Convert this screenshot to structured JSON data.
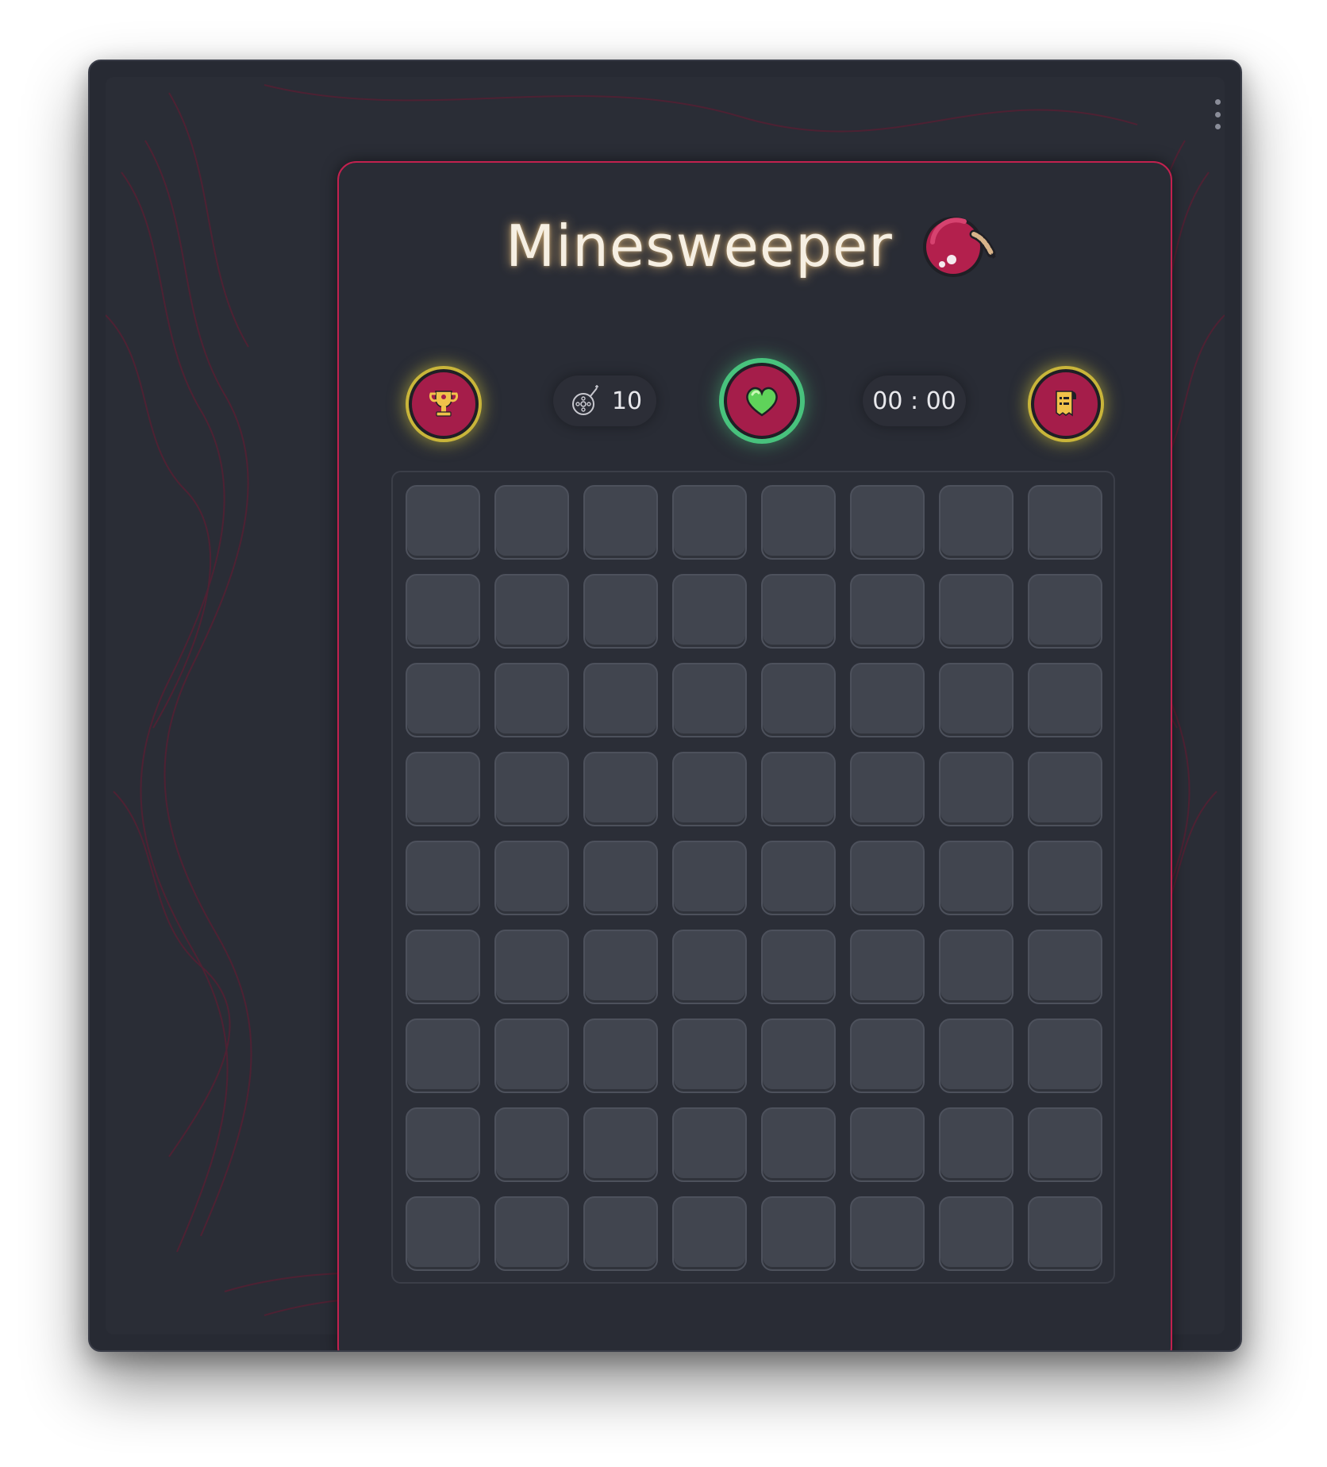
{
  "app": {
    "title": "Minesweeper"
  },
  "toolbar": {
    "mine_count": "10",
    "timer": "00 : 00",
    "leaderboard_icon": "trophy-icon",
    "status_icon": "heart-icon",
    "rules_icon": "rules-scroll-icon",
    "mine_counter_icon": "mine-icon"
  },
  "board": {
    "rows": 9,
    "columns": 8,
    "cell_state": "unrevealed"
  },
  "colors": {
    "background": "#272a33",
    "panel_border": "#c2214f",
    "accent_red": "#a51d4a",
    "button_glow": "#c9b53a",
    "status_green": "#48c27d",
    "cell": "#41454f",
    "title_glow": "#f6c478"
  }
}
